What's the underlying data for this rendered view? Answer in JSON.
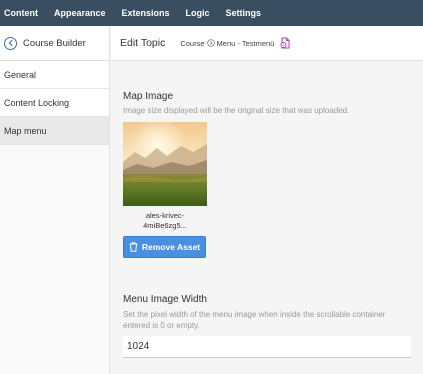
{
  "topnav": {
    "items": [
      "Content",
      "Appearance",
      "Extensions",
      "Logic",
      "Settings"
    ]
  },
  "sidebar": {
    "title": "Course Builder",
    "back_icon": "arrow-left-circle-icon",
    "items": [
      {
        "label": "General",
        "active": false
      },
      {
        "label": "Content Locking",
        "active": false
      },
      {
        "label": "Map menu",
        "active": true
      }
    ]
  },
  "header": {
    "title": "Edit Topic",
    "breadcrumb": [
      "Course",
      "Menu - Testmenü"
    ],
    "breadcrumb_sep_icon": "chevron-right-circle-icon",
    "doc_icon": "document-icon"
  },
  "map_image": {
    "label": "Map Image",
    "help": "Image size displayed will be the original size that was uploaded.",
    "asset_name_line1": "ales-krivec-",
    "asset_name_line2": "4miBe6zg5...",
    "remove_label": "Remove Asset",
    "remove_icon": "trash-icon"
  },
  "menu_image_width": {
    "label": "Menu Image Width",
    "help_line1": "Set the pixel width of the menu image when inside the scrollable container",
    "help_line2": "entered is 0 or empty.",
    "value": "1024"
  },
  "colors": {
    "topnav_bg": "#394e60",
    "accent": "#4a90e2",
    "doc_icon": "#b03fb0"
  }
}
